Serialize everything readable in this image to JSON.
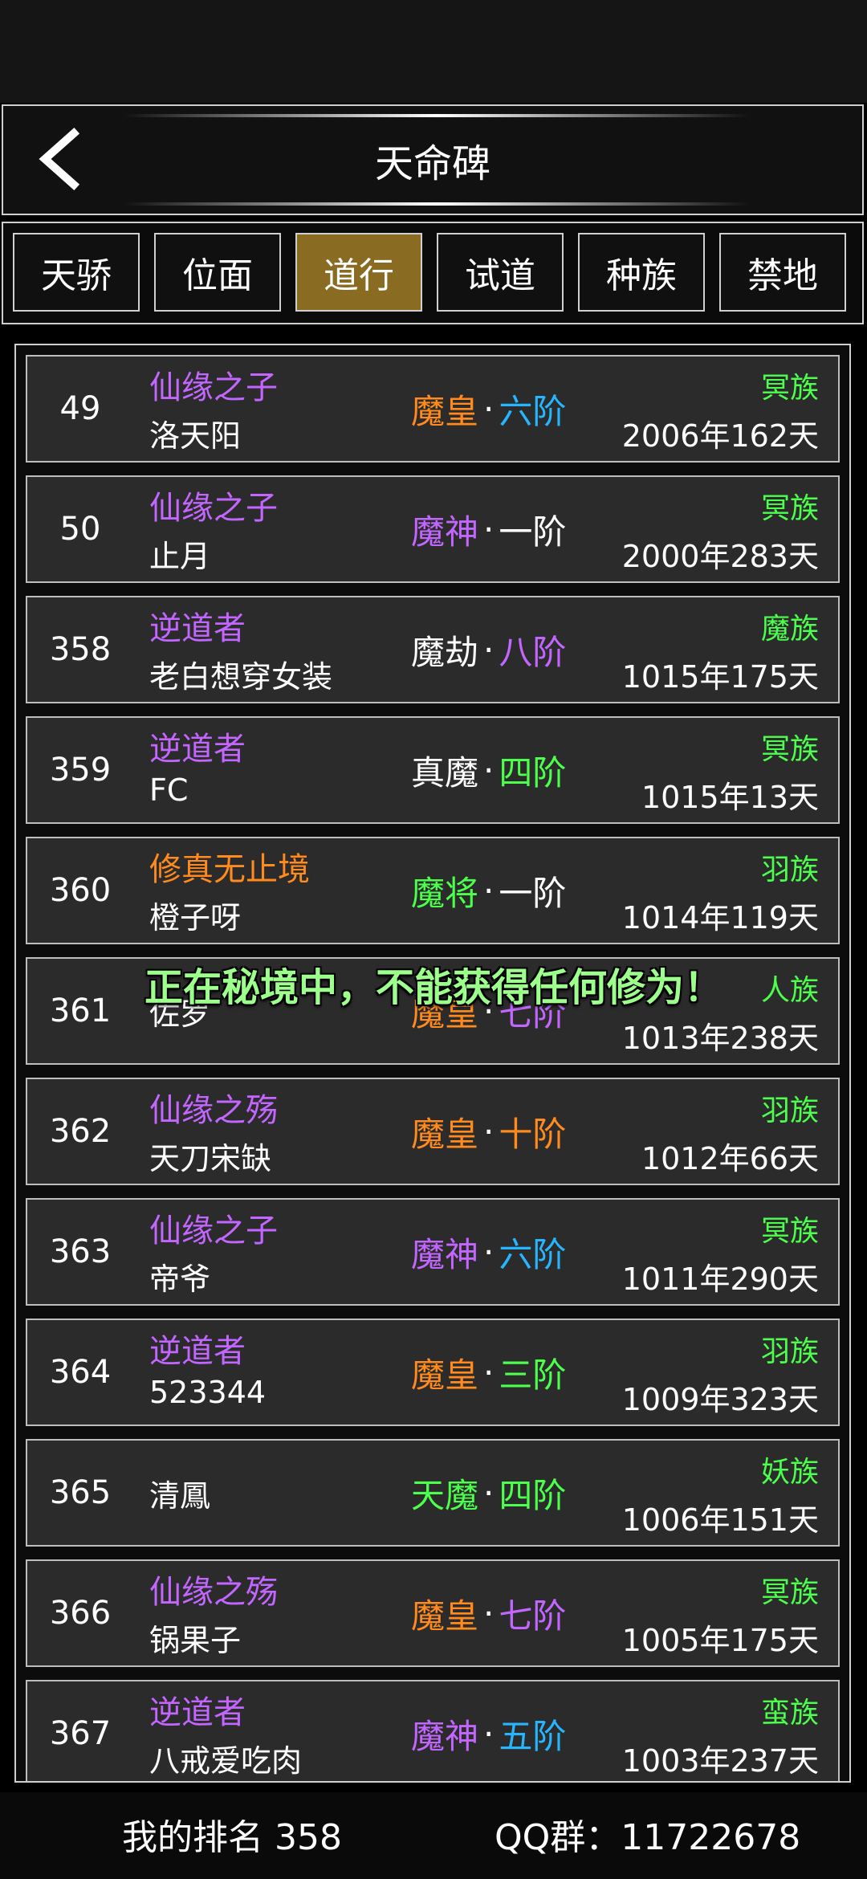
{
  "header": {
    "title": "天命碑"
  },
  "tabs": [
    {
      "label": "天骄",
      "active": false
    },
    {
      "label": "位面",
      "active": false
    },
    {
      "label": "道行",
      "active": true
    },
    {
      "label": "试道",
      "active": false
    },
    {
      "label": "种族",
      "active": false
    },
    {
      "label": "禁地",
      "active": false
    }
  ],
  "rows": [
    {
      "rank": "49",
      "title": "仙缘之子",
      "title_color": "#c266ff",
      "name": "洛天阳",
      "realm": "魔皇",
      "realm_color": "#ff8a1e",
      "stage": "六阶",
      "stage_color": "#26b6ff",
      "race": "冥族",
      "time": "2006年162天"
    },
    {
      "rank": "50",
      "title": "仙缘之子",
      "title_color": "#c266ff",
      "name": "止月",
      "realm": "魔神",
      "realm_color": "#c266ff",
      "stage": "一阶",
      "stage_color": "#ffffff",
      "race": "冥族",
      "time": "2000年283天"
    },
    {
      "rank": "358",
      "title": "逆道者",
      "title_color": "#c266ff",
      "name": "老白想穿女装",
      "realm": "魔劫",
      "realm_color": "#ffffff",
      "stage": "八阶",
      "stage_color": "#c266ff",
      "race": "魔族",
      "time": "1015年175天"
    },
    {
      "rank": "359",
      "title": "逆道者",
      "title_color": "#c266ff",
      "name": "FC",
      "realm": "真魔",
      "realm_color": "#ffffff",
      "stage": "四阶",
      "stage_color": "#4cff4c",
      "race": "冥族",
      "time": "1015年13天"
    },
    {
      "rank": "360",
      "title": "修真无止境",
      "title_color": "#ff8a1e",
      "name": "橙子呀",
      "realm": "魔将",
      "realm_color": "#4cff4c",
      "stage": "一阶",
      "stage_color": "#ffffff",
      "race": "羽族",
      "time": "1014年119天"
    },
    {
      "rank": "361",
      "title": "",
      "title_color": "#c266ff",
      "name": "佐罗",
      "realm": "魔皇",
      "realm_color": "#ff8a1e",
      "stage": "七阶",
      "stage_color": "#c266ff",
      "race": "人族",
      "time": "1013年238天"
    },
    {
      "rank": "362",
      "title": "仙缘之殇",
      "title_color": "#c266ff",
      "name": "天刀宋缺",
      "realm": "魔皇",
      "realm_color": "#ff8a1e",
      "stage": "十阶",
      "stage_color": "#ff8a1e",
      "race": "羽族",
      "time": "1012年66天"
    },
    {
      "rank": "363",
      "title": "仙缘之子",
      "title_color": "#c266ff",
      "name": "帝爷",
      "realm": "魔神",
      "realm_color": "#c266ff",
      "stage": "六阶",
      "stage_color": "#26b6ff",
      "race": "冥族",
      "time": "1011年290天"
    },
    {
      "rank": "364",
      "title": "逆道者",
      "title_color": "#c266ff",
      "name": "523344",
      "realm": "魔皇",
      "realm_color": "#ff8a1e",
      "stage": "三阶",
      "stage_color": "#4cff4c",
      "race": "羽族",
      "time": "1009年323天"
    },
    {
      "rank": "365",
      "title": "",
      "title_color": "#c266ff",
      "name": "清鳳",
      "realm": "天魔",
      "realm_color": "#4cff4c",
      "stage": "四阶",
      "stage_color": "#4cff4c",
      "race": "妖族",
      "time": "1006年151天"
    },
    {
      "rank": "366",
      "title": "仙缘之殇",
      "title_color": "#c266ff",
      "name": "锅果子",
      "realm": "魔皇",
      "realm_color": "#ff8a1e",
      "stage": "七阶",
      "stage_color": "#c266ff",
      "race": "冥族",
      "time": "1005年175天"
    },
    {
      "rank": "367",
      "title": "逆道者",
      "title_color": "#c266ff",
      "name": "八戒爱吃肉",
      "realm": "魔神",
      "realm_color": "#c266ff",
      "stage": "五阶",
      "stage_color": "#26b6ff",
      "race": "蛮族",
      "time": "1003年237天"
    }
  ],
  "colors": {
    "race": "#4cff4c",
    "active_tab": "#8a6b22"
  },
  "toast": "正在秘境中，不能获得任何修为！",
  "footer": {
    "my_rank": "我的排名 358",
    "qq_group": "QQ群：11722678"
  }
}
